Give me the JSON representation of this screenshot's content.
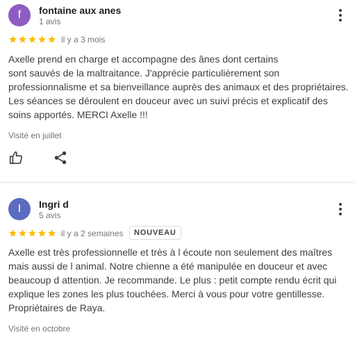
{
  "reviews": [
    {
      "avatar_letter": "f",
      "avatar_color": "#8e5cc2",
      "name": "fontaine aux anes",
      "review_count": "1 avis",
      "rating": 5,
      "date": "il y a 3 mois",
      "badge": "",
      "text": "Axelle prend en charge et accompagne des ânes dont certains\nsont sauvés de la maltraitance. J'apprécie particulièrement son\nprofessionnalisme et sa bienveillance auprès des animaux et des propriétaires.\nLes séances se déroulent en douceur avec un suivi précis et explicatif des\nsoins apportés. MERCI Axelle !!!",
      "visited": "Visité en juillet",
      "actions": [
        "thumbs-up-icon",
        "share-icon"
      ]
    },
    {
      "avatar_letter": "I",
      "avatar_color": "#5c6bc0",
      "name": "Ingri d",
      "review_count": "5 avis",
      "rating": 5,
      "date": "il y a 2 semaines",
      "badge": "NOUVEAU",
      "text": "Axelle est très professionnelle et très à l écoute non seulement des maîtres\nmais aussi de l animal. Notre chienne a été manipulée en douceur et avec\nbeaucoup d attention. Je recommande. Le plus : petit compte rendu écrit qui\nexplique les zones les plus touchées. Merci à vous pour votre gentillesse.\nPropriétaires de Raya.",
      "visited": "Visité en octobre"
    }
  ],
  "colors": {
    "star": "#fbbc04",
    "text": "#3c4043",
    "muted": "#70757a",
    "divider": "#e0e0e0"
  },
  "icons": {
    "menu": "more-vert-icon",
    "star": "star-icon",
    "like": "thumbs-up-icon",
    "share": "share-icon"
  }
}
